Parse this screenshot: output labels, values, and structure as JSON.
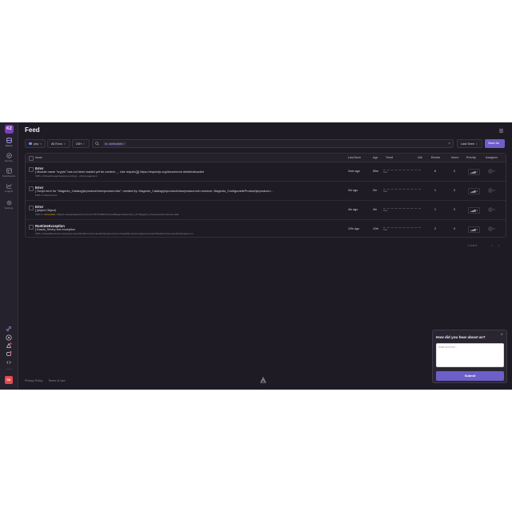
{
  "org": {
    "initials": "KZ"
  },
  "user": {
    "initials": "SK"
  },
  "sidebar": {
    "items": [
      {
        "label": "Issues",
        "icon": "issues-icon",
        "active": true
      },
      {
        "label": "Explore",
        "icon": "explore-icon"
      },
      {
        "label": "Dashboards",
        "icon": "dashboards-icon"
      },
      {
        "label": "Insights",
        "icon": "insights-icon"
      },
      {
        "label": "Settings",
        "icon": "settings-icon"
      }
    ],
    "bottom_icons": [
      "link-icon",
      "help-icon",
      "broadcast-icon",
      "status-icon",
      "collapse-icon"
    ]
  },
  "header": {
    "title": "Feed"
  },
  "filters": {
    "project": "php",
    "environment": "All Envs",
    "period": "24H",
    "search_token": "is: unresolved",
    "sort": "Last Seen",
    "save_label": "Save As"
  },
  "table": {
    "columns": {
      "issue": "Issue",
      "last_seen": "Last Seen",
      "age": "Age",
      "trend": "Trend",
      "trend_period": "24h",
      "events": "Events",
      "users": "Users",
      "priority": "Priority",
      "assignee": "Assignee"
    },
    "rows": [
      {
        "type": "Error",
        "message": "[ Module name \"crypto\" has not been loaded yet for context: _. Use require([]) https://requirejs.org/docs/errors.html#notloaded",
        "meta": "PHP-4  /lib/web/mage/requirejs-config.js  ·  phtml-magento-ti",
        "unhandled": "",
        "last_seen": "2min ago",
        "age": "59m",
        "trend_label": "New",
        "events": "6",
        "users": "0",
        "priority": "Med"
      },
      {
        "type": "Error",
        "message": "[ Script error for \"Magento_Catalog/js/product/view/product-info\", needed by: Magento_Catalog/js/product/view/product-info-resolver, Magento_ConfigurableProduct/js/product-i...",
        "meta": "PHP-3  ?/docs/errors",
        "unhandled": "",
        "last_seen": "2hr ago",
        "age": "2hr",
        "trend_label": "New",
        "events": "1",
        "users": "0",
        "priority": "Med"
      },
      {
        "type": "Error",
        "message": "[ [object Object]",
        "meta": "PHP-2",
        "unhandled": "Unhandled",
        "meta_extra": "/Object.ssisejs/require/common/1713731489/frontend/Magento/theme/en_PL/Magento_Customer/js/customer-data",
        "last_seen": "4hr ago",
        "age": "4hr",
        "trend_label": "New",
        "events": "1",
        "users": "0",
        "priority": "Med"
      },
      {
        "type": "RuntimeException",
        "message": "[ Kawal_Sentry test exception",
        "meta": "PHP-1  /Kawal/Sentry/Console/Command/TestErrorCommand/Interceptor.php in Kawal/Sentry/Console/Command/TestErrorCommand/Interceptor.run",
        "unhandled": "",
        "last_seen": "12hr ago",
        "age": "12hr",
        "trend_label": "New",
        "events": "2",
        "users": "0",
        "priority": "Med"
      }
    ]
  },
  "pagination": {
    "text": "1-4 of 4",
    "prev": "‹",
    "next": "›"
  },
  "footer": {
    "privacy": "Privacy Policy",
    "terms": "Terms of Use"
  },
  "survey": {
    "question": "How did you hear about us?",
    "placeholder": "Enter text here...",
    "submit": "Submit",
    "close": "×"
  }
}
